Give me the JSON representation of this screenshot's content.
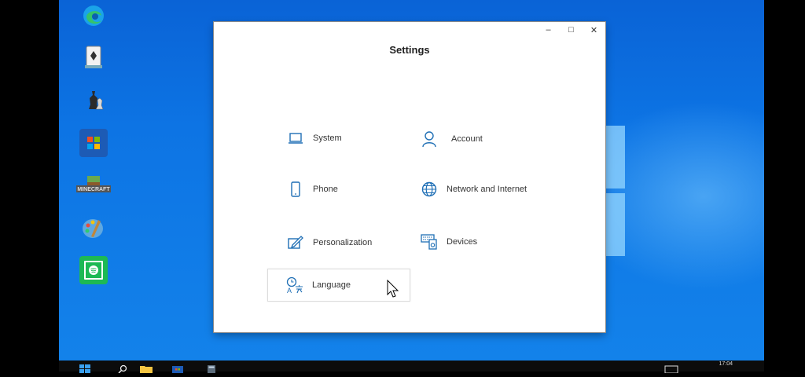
{
  "window": {
    "title": "Settings",
    "controls": {
      "minimize": "–",
      "maximize": "□",
      "close": "✕"
    }
  },
  "settings_items": [
    {
      "id": "system",
      "label": "System",
      "icon": "laptop-icon"
    },
    {
      "id": "account",
      "label": "Account",
      "icon": "person-icon"
    },
    {
      "id": "phone",
      "label": "Phone",
      "icon": "phone-icon"
    },
    {
      "id": "network",
      "label": "Network and Internet",
      "icon": "globe-icon"
    },
    {
      "id": "personalization",
      "label": "Personalization",
      "icon": "paint-pen-icon"
    },
    {
      "id": "devices",
      "label": "Devices",
      "icon": "keyboard-speaker-icon"
    },
    {
      "id": "language",
      "label": "Language",
      "icon": "language-icon",
      "selected": true
    }
  ],
  "desktop_icons": [
    "edge-icon",
    "solitaire-icon",
    "chess-icon",
    "store-icon",
    "minecraft-icon",
    "paint-icon",
    "spotify-icon"
  ],
  "desktop_icon_text": {
    "minecraft": "MINECRAFT"
  },
  "taskbar": {
    "clock": "17:04",
    "items": [
      "start-icon",
      "search-icon",
      "file-explorer-icon",
      "store-icon",
      "calculator-icon"
    ]
  },
  "colors": {
    "accent": "#1f6fb5",
    "desktop": "#0d74e4"
  }
}
